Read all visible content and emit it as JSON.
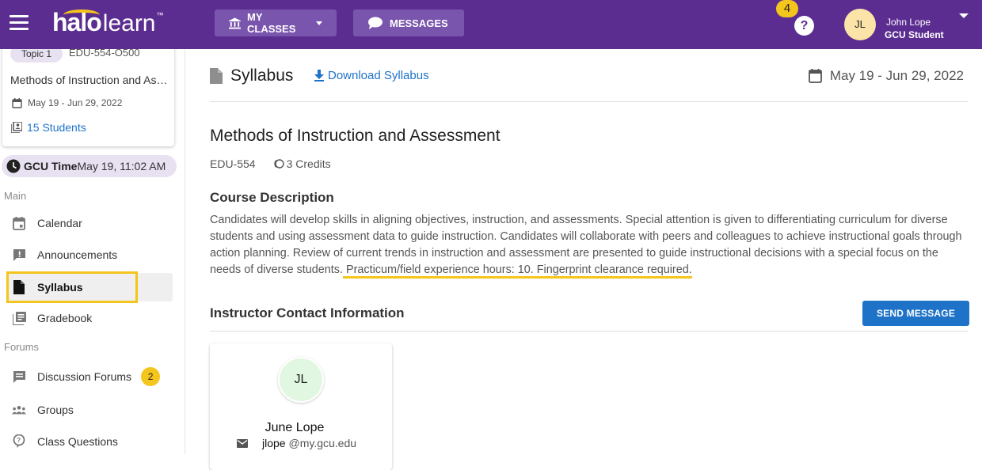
{
  "topbar": {
    "logo_brand": "halo",
    "logo_product": "learn",
    "logo_tm": "™",
    "my_classes_label": "MY CLASSES",
    "messages_label": "MESSAGES",
    "help_badge_count": "4",
    "help_icon": "?",
    "user_initials": "JL",
    "user_name": "John Lope",
    "user_role": "GCU Student",
    "brand_color": "#5b2d90",
    "accent_color": "#f4c51c"
  },
  "sidebar": {
    "class_card": {
      "topic": "Topic 1",
      "course_code": "EDU-554-O500",
      "title": "Methods of Instruction and Assessment",
      "dates": "May 19 - Jun 29, 2022",
      "students": "15 Students"
    },
    "gcu_time": {
      "label": "GCU Time",
      "value": "May 19, 11:02 AM"
    },
    "sections": {
      "main": "Main",
      "forums": "Forums"
    },
    "items": [
      {
        "label": "Calendar",
        "icon": "calendar-icon"
      },
      {
        "label": "Announcements",
        "icon": "announcement-icon"
      },
      {
        "label": "Syllabus",
        "icon": "document-icon",
        "active": true
      },
      {
        "label": "Gradebook",
        "icon": "gradebook-icon"
      },
      {
        "label": "Discussion Forums",
        "icon": "forum-icon",
        "badge": "2"
      },
      {
        "label": "Groups",
        "icon": "groups-icon"
      },
      {
        "label": "Class Questions",
        "icon": "question-icon"
      }
    ]
  },
  "main": {
    "title": "Syllabus",
    "download_label": "Download Syllabus",
    "date_range": "May 19 - Jun 29, 2022",
    "course_title": "Methods of Instruction and Assessment",
    "course_code": "EDU-554",
    "credits": "3 Credits",
    "description_heading": "Course Description",
    "description_text": "Candidates will develop skills in aligning objectives, instruction, and assessments. Special attention is given to differentiating curriculum for diverse students and using assessment data to guide instruction. Candidates will collaborate with peers and colleagues to achieve instructional goals through action planning. Review of current trends in instruction and assessment are presented to guide instructional decisions with a special focus on the needs of diverse students.",
    "description_highlight": " Practicum/field experience hours: 10. Fingerprint clearance required.",
    "contact_heading": "Instructor Contact Information",
    "send_message_label": "SEND MESSAGE",
    "instructor": {
      "initials": "JL",
      "name": "June Lope",
      "email_user": "jlope",
      "email_domain": "@my.gcu.edu"
    }
  }
}
